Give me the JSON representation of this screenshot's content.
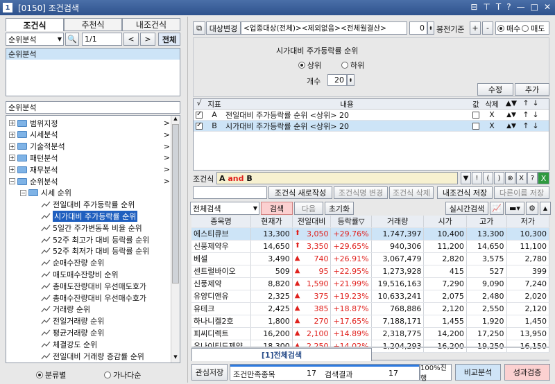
{
  "title": {
    "number": "1",
    "code": "[0150]",
    "name": "조건검색"
  },
  "left": {
    "tabs": [
      {
        "label": "조건식"
      },
      {
        "label": "추천식"
      },
      {
        "label": "내조건식"
      }
    ],
    "category": "순위분석",
    "page": "1/1",
    "all_btn": "전체",
    "list_item": "순위분석",
    "section_label": "순위분석",
    "tree": [
      {
        "label": "범위지정",
        "arrow": ">"
      },
      {
        "label": "시세분석",
        "arrow": ">"
      },
      {
        "label": "기술적분석",
        "arrow": ">"
      },
      {
        "label": "패턴분석",
        "arrow": ">"
      },
      {
        "label": "재무분석",
        "arrow": ">"
      },
      {
        "label": "순위분석",
        "arrow": ">"
      },
      {
        "label": "시세 순위"
      },
      {
        "label": "전일대비 주가등락률 순위"
      },
      {
        "label": "시가대비 주가등락률 순위"
      },
      {
        "label": "5일간 주가변동폭 비율 순위"
      },
      {
        "label": "52주 최고가 대비 등락률 순위"
      },
      {
        "label": "52주 최저가 대비 등락률 순위"
      },
      {
        "label": "순매수잔량 순위"
      },
      {
        "label": "매도매수잔량비 순위"
      },
      {
        "label": "총매도잔량대비 우선매도호가"
      },
      {
        "label": "총매수잔량대비 우선매수호가"
      },
      {
        "label": "거래량 순위"
      },
      {
        "label": "전일거래량 순위"
      },
      {
        "label": "평균거래량 순위"
      },
      {
        "label": "체결강도 순위"
      },
      {
        "label": "전일대비 거래량 증감률 순위"
      }
    ],
    "radio1": "분류별",
    "radio2": "가나다순"
  },
  "top": {
    "target_btn": "대상변경",
    "target_text": "<업종대상(전체)><제외없음><전체월결산>",
    "num": "0",
    "bong": "봉전기준",
    "plus": "+",
    "minus": "-",
    "buy": "매수",
    "sell": "매도"
  },
  "cond": {
    "title": "시가대비 주가등락률 순위",
    "upper": "상위",
    "lower": "하위",
    "count_label": "개수",
    "count": "20",
    "edit_btn": "수정",
    "add_btn": "추가"
  },
  "ctable": {
    "headers": [
      "√",
      "지표",
      "내용",
      "값",
      "삭제",
      "▲▼",
      "↑",
      "↓"
    ],
    "rows": [
      {
        "code": "A",
        "text": "전일대비 주가등락률 순위 <상위> 20",
        "del": "X",
        "move": "▲▼",
        "up": "↑",
        "down": "↓"
      },
      {
        "code": "B",
        "text": "시가대비 주가등락률 순위 <상위> 20",
        "del": "X",
        "move": "▲▼",
        "up": "↑",
        "down": "↓"
      }
    ]
  },
  "formula": {
    "label": "조건식",
    "a": "A",
    "and": "and",
    "b": "B",
    "ops": [
      "▼",
      "!",
      "(",
      ")",
      "⊗",
      "X",
      "?"
    ]
  },
  "actions": {
    "new": "조건식 새로작성",
    "rename": "조건식명 변경",
    "delete": "조건식 삭제",
    "save": "내조건식 저장",
    "save_as": "다른이름 저장"
  },
  "search": {
    "scope": "전체검색",
    "search": "검색",
    "next": "다음",
    "reset": "초기화",
    "realtime": "실시간검색"
  },
  "grid": {
    "headers": [
      "종목명",
      "현재가",
      "전일대비",
      "등락률▽",
      "거래량",
      "시가",
      "고가",
      "저가"
    ],
    "rows": [
      [
        "에스티큐브",
        "13,300",
        "3,050",
        "+29.76%",
        "1,747,397",
        "10,400",
        "13,300",
        "10,300"
      ],
      [
        "신풍제약우",
        "14,650",
        "3,350",
        "+29.65%",
        "940,306",
        "11,200",
        "14,650",
        "11,100"
      ],
      [
        "베셀",
        "3,490",
        "740",
        "+26.91%",
        "3,067,479",
        "2,820",
        "3,575",
        "2,780"
      ],
      [
        "센트럴바이오",
        "509",
        "95",
        "+22.95%",
        "1,273,928",
        "415",
        "527",
        "399"
      ],
      [
        "신풍제약",
        "8,820",
        "1,590",
        "+21.99%",
        "19,516,163",
        "7,290",
        "9,090",
        "7,240"
      ],
      [
        "유양디앤유",
        "2,325",
        "375",
        "+19.23%",
        "10,633,241",
        "2,075",
        "2,480",
        "2,020"
      ],
      [
        "유테크",
        "2,425",
        "385",
        "+18.87%",
        "768,886",
        "2,120",
        "2,550",
        "2,120"
      ],
      [
        "하나니켈2호",
        "1,800",
        "270",
        "+17.65%",
        "7,188,171",
        "1,455",
        "1,920",
        "1,450"
      ],
      [
        "피씨디렉트",
        "16,200",
        "2,100",
        "+14.89%",
        "2,318,775",
        "14,200",
        "17,250",
        "13,950"
      ],
      [
        "유나이티드제약",
        "18,300",
        "2,250",
        "+14.02%",
        "1,204,293",
        "16,200",
        "19,250",
        "16,150"
      ]
    ]
  },
  "result_tab": "[1]전체검색",
  "bottom": {
    "save": "관심저장",
    "match_label": "조건만족종목",
    "match": "17",
    "result_label": "검색결과",
    "result": "17",
    "progress": "100%진행",
    "compare": "비교분석",
    "verify": "성과검증"
  },
  "colors": {
    "accent": "#2e528d",
    "up": "#e0201c",
    "selected": "#cde4f7",
    "verify": "#fbd0d0",
    "compare": "#cfe4f7"
  }
}
